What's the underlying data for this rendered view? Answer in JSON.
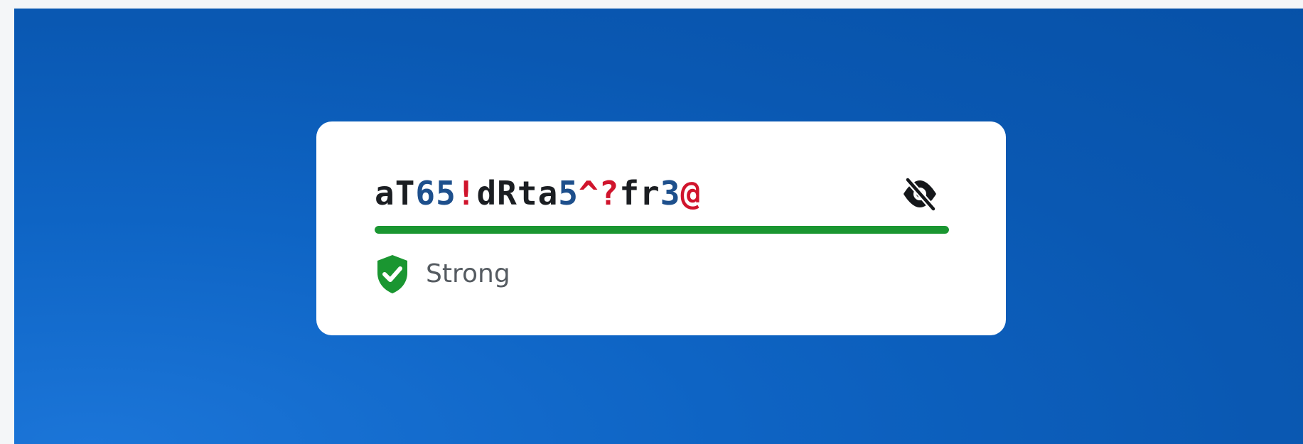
{
  "password": {
    "segments": [
      {
        "text": "aT",
        "kind": "letter"
      },
      {
        "text": "65",
        "kind": "digit"
      },
      {
        "text": "!",
        "kind": "symbol"
      },
      {
        "text": "dRta",
        "kind": "letter"
      },
      {
        "text": "5",
        "kind": "digit"
      },
      {
        "text": "^?",
        "kind": "symbol"
      },
      {
        "text": "fr",
        "kind": "letter"
      },
      {
        "text": "3",
        "kind": "digit"
      },
      {
        "text": "@",
        "kind": "symbol"
      }
    ],
    "colors": {
      "letter": "#1b1e22",
      "digit": "#1d4f8c",
      "symbol": "#d0142c"
    }
  },
  "visibility_toggle": {
    "icon": "eye-slash-icon",
    "state": "hidden"
  },
  "strength": {
    "label": "Strong",
    "level": 1.0,
    "color": "#1a9631",
    "icon": "shield-check-icon"
  }
}
